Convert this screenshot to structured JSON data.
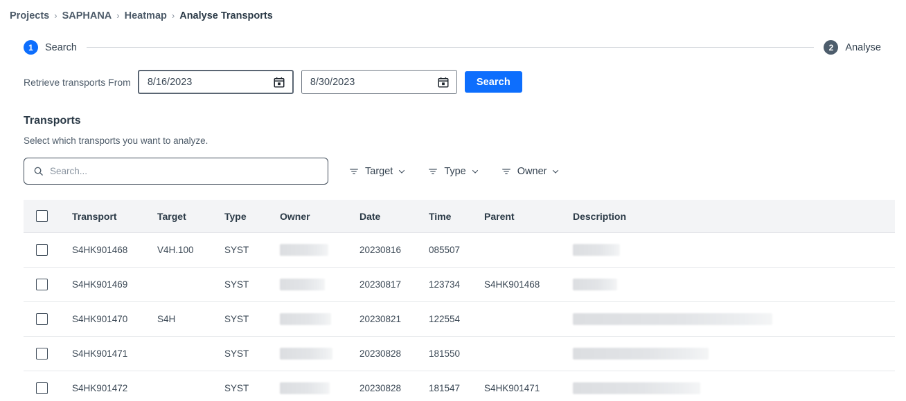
{
  "breadcrumb": {
    "items": [
      {
        "label": "Projects",
        "current": false
      },
      {
        "label": "SAPHANA",
        "current": false
      },
      {
        "label": "Heatmap",
        "current": false
      },
      {
        "label": "Analyse Transports",
        "current": true
      }
    ],
    "separator": "›"
  },
  "stepper": {
    "steps": [
      {
        "number": "1",
        "label": "Search",
        "state": "active",
        "color": "#0d6efd"
      },
      {
        "number": "2",
        "label": "Analyse",
        "state": "inactive",
        "color": "#4d5d6c"
      }
    ]
  },
  "search_panel": {
    "retrieve_label": "Retrieve transports From",
    "date_from": "8/16/2023",
    "date_to": "8/30/2023",
    "search_button": "Search",
    "calendar_icon": "calendar-icon"
  },
  "transports": {
    "title": "Transports",
    "subtitle": "Select which transports you want to analyze.",
    "search_placeholder": "Search...",
    "search_value": "",
    "search_icon": "search-icon",
    "filters": [
      {
        "label": "Target",
        "icon": "filter-icon",
        "chevron": "chevron-down-icon"
      },
      {
        "label": "Type",
        "icon": "filter-icon",
        "chevron": "chevron-down-icon"
      },
      {
        "label": "Owner",
        "icon": "filter-icon",
        "chevron": "chevron-down-icon"
      }
    ],
    "columns": [
      "Transport",
      "Target",
      "Type",
      "Owner",
      "Date",
      "Time",
      "Parent",
      "Description"
    ],
    "rows": [
      {
        "checked": false,
        "transport": "S4HK901468",
        "target": "V4H.100",
        "type": "SYST",
        "owner": "",
        "owner_redacted": true,
        "owner_width": 70,
        "date": "20230816",
        "time": "085507",
        "parent": "",
        "description": "",
        "description_redacted": true,
        "description_width": 68
      },
      {
        "checked": false,
        "transport": "S4HK901469",
        "target": "",
        "type": "SYST",
        "owner": "",
        "owner_redacted": true,
        "owner_width": 65,
        "date": "20230817",
        "time": "123734",
        "parent": "S4HK901468",
        "description": "",
        "description_redacted": true,
        "description_width": 64
      },
      {
        "checked": false,
        "transport": "S4HK901470",
        "target": "S4H",
        "type": "SYST",
        "owner": "",
        "owner_redacted": true,
        "owner_width": 74,
        "date": "20230821",
        "time": "122554",
        "parent": "",
        "description": "",
        "description_redacted": true,
        "description_width": 288
      },
      {
        "checked": false,
        "transport": "S4HK901471",
        "target": "",
        "type": "SYST",
        "owner": "",
        "owner_redacted": true,
        "owner_width": 76,
        "date": "20230828",
        "time": "181550",
        "parent": "",
        "description": "",
        "description_redacted": true,
        "description_width": 196
      },
      {
        "checked": false,
        "transport": "S4HK901472",
        "target": "",
        "type": "SYST",
        "owner": "",
        "owner_redacted": true,
        "owner_width": 72,
        "date": "20230828",
        "time": "181547",
        "parent": "S4HK901471",
        "description": "",
        "description_redacted": true,
        "description_width": 184
      }
    ]
  },
  "colors": {
    "accent": "#0d6efd",
    "step_inactive": "#4d5d6c",
    "text": "#32404e",
    "muted": "#4c5a68",
    "header_bg": "#f3f4f6",
    "border": "#e6e8eb"
  }
}
